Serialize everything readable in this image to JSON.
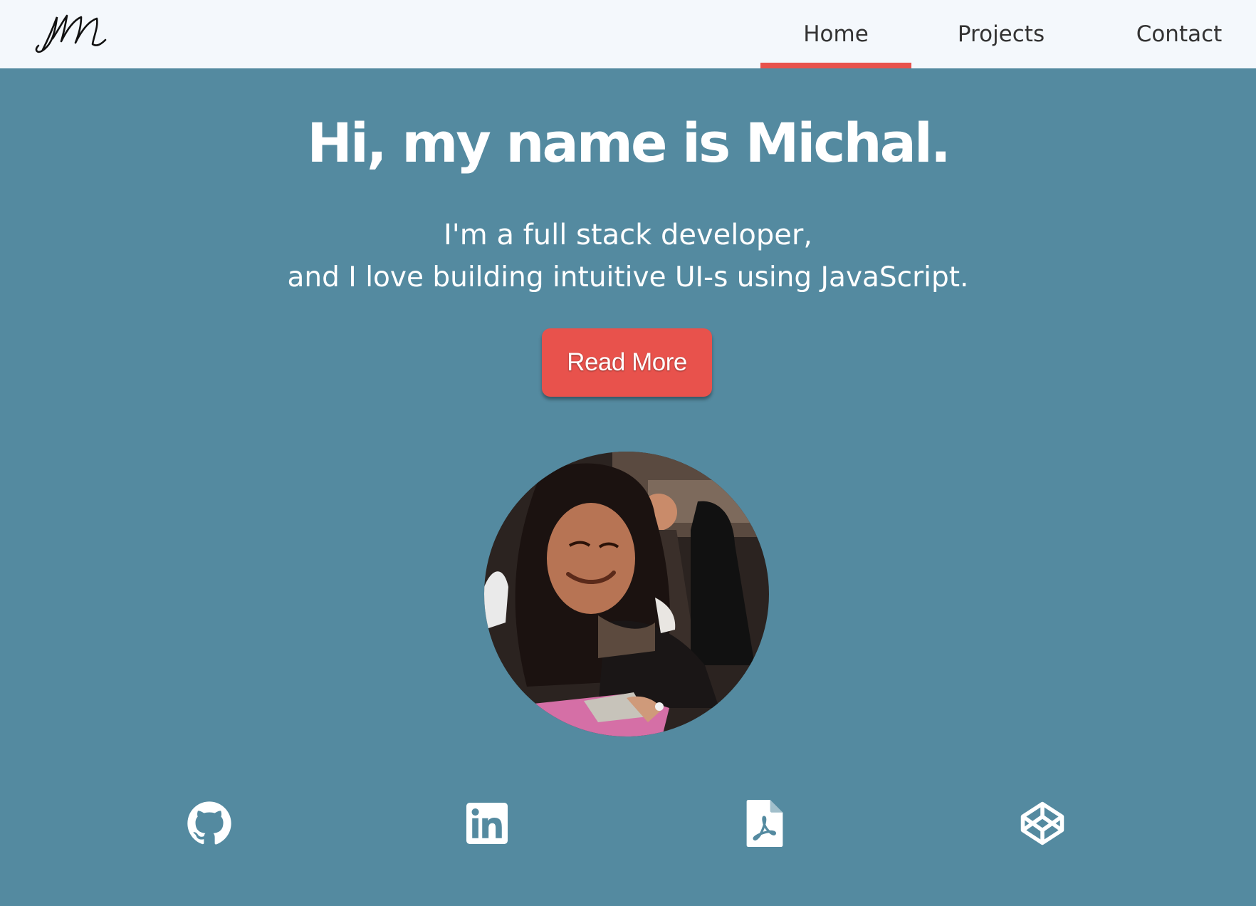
{
  "header": {
    "logo_text": "m",
    "nav": [
      {
        "label": "Home",
        "active": true
      },
      {
        "label": "Projects",
        "active": false
      },
      {
        "label": "Contact",
        "active": false
      }
    ],
    "active_indicator_color": "#e8524c"
  },
  "hero": {
    "title": "Hi, my name is Michal.",
    "subtitle_line1": "I'm a full stack developer,",
    "subtitle_line2": "and I love building intuitive UI-s using JavaScript.",
    "cta_label": "Read More",
    "cta_color": "#e8524c",
    "background_color": "#548aa0"
  },
  "profile": {
    "avatar": "profile-photo"
  },
  "social_links": [
    {
      "icon": "github-icon"
    },
    {
      "icon": "linkedin-icon"
    },
    {
      "icon": "pdf-resume-icon"
    },
    {
      "icon": "codepen-icon"
    }
  ]
}
